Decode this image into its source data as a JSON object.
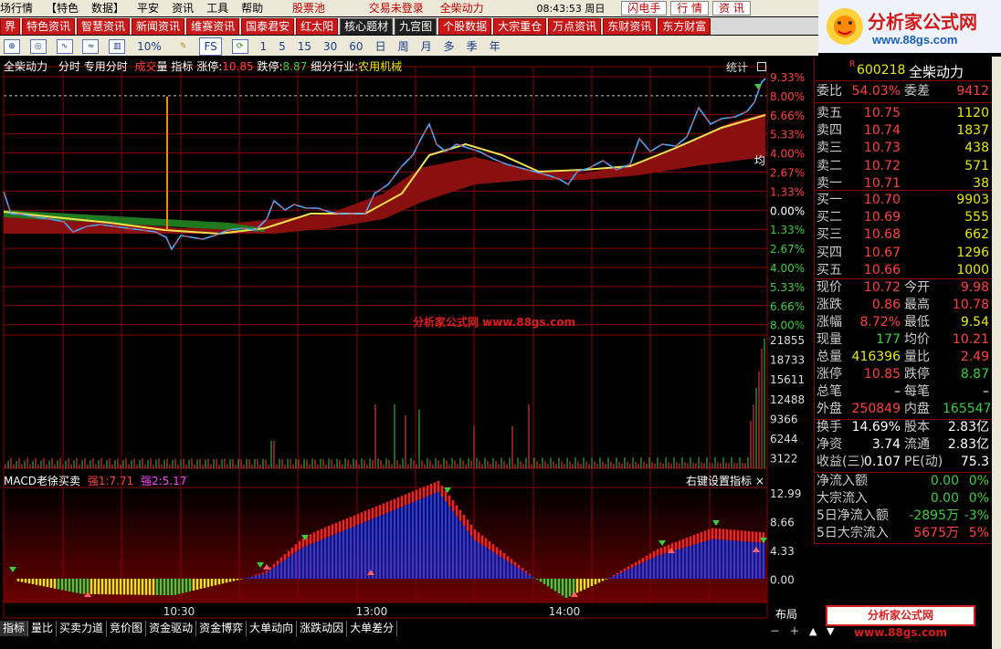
{
  "menubar": {
    "left": [
      "场行情",
      "【特色",
      "数据】",
      "平安",
      "资讯",
      "工具",
      "帮助"
    ],
    "pool": "股票池",
    "trade_status": "交易未登录",
    "stock": "全柴动力",
    "time": "08:43:53 周日",
    "buttons": [
      "闪电手",
      "行 情",
      "资 讯"
    ]
  },
  "logo": {
    "name": "分析家公式网",
    "url": "www.88gs.com"
  },
  "tabs": [
    {
      "label": "界",
      "dark": false
    },
    {
      "label": "特色资讯",
      "dark": false
    },
    {
      "label": "智慧资讯",
      "dark": false
    },
    {
      "label": "新闻资讯",
      "dark": false
    },
    {
      "label": "维赛资讯",
      "dark": false
    },
    {
      "label": "国泰君安",
      "dark": false
    },
    {
      "label": "红太阳",
      "dark": false
    },
    {
      "label": "核心题材",
      "dark": true
    },
    {
      "label": "九宫图",
      "dark": true
    },
    {
      "label": "个股数据",
      "dark": false
    },
    {
      "label": "大宗重仓",
      "dark": false
    },
    {
      "label": "万点资讯",
      "dark": false
    },
    {
      "label": "东财资讯",
      "dark": false
    },
    {
      "label": "东方财富",
      "dark": false
    }
  ],
  "toolbar": {
    "percent": "10%",
    "fs": "FS",
    "periods": [
      "1",
      "5",
      "15",
      "30",
      "60",
      "日",
      "周",
      "月",
      "多",
      "季",
      "年"
    ]
  },
  "info": {
    "name": "全柴动力",
    "mode1": "分时",
    "mode2": "专用分时",
    "vol_a": "成交",
    "vol_b": "量",
    "indicator": "指标",
    "limit_up_label": "涨停:",
    "limit_up": "10.85",
    "limit_down_label": "跌停:",
    "limit_down": "8.87",
    "industry_label": "细分行业:",
    "industry": "农用机械",
    "stat": "统计",
    "mark": "均"
  },
  "watermark": "分析家公式网 www.88gs.com",
  "macd": {
    "title": "MACD老徐买卖",
    "s1_label": "强1:",
    "s1": "7.71",
    "s2_label": "强2:",
    "s2": "5.17",
    "settings": "右键设置指标 ×"
  },
  "price_axis": [
    "9.33%",
    "8.00%",
    "6.66%",
    "5.33%",
    "4.00%",
    "2.67%",
    "1.33%",
    "0.00%",
    "1.33%",
    "2.67%",
    "4.00%",
    "5.33%",
    "6.66%",
    "8.00%"
  ],
  "volume_axis": [
    "21855",
    "18733",
    "15611",
    "12488",
    "9366",
    "6244",
    "3122"
  ],
  "macd_axis": [
    "12.99",
    "8.66",
    "4.33",
    "0.00"
  ],
  "time_axis": [
    "10:30",
    "13:00",
    "14:00"
  ],
  "quote": {
    "code_prefix": "R",
    "code": "600218",
    "name": "全柴动力",
    "wei_bi_label": "委比",
    "wei_bi": "54.03%",
    "wei_cha_label": "委差",
    "wei_cha": "9412",
    "asks": [
      {
        "label": "卖五",
        "price": "10.75",
        "vol": "1120"
      },
      {
        "label": "卖四",
        "price": "10.74",
        "vol": "1837"
      },
      {
        "label": "卖三",
        "price": "10.73",
        "vol": "438"
      },
      {
        "label": "卖二",
        "price": "10.72",
        "vol": "571"
      },
      {
        "label": "卖一",
        "price": "10.71",
        "vol": "38"
      }
    ],
    "bids": [
      {
        "label": "买一",
        "price": "10.70",
        "vol": "9903"
      },
      {
        "label": "买二",
        "price": "10.69",
        "vol": "555"
      },
      {
        "label": "买三",
        "price": "10.68",
        "vol": "662"
      },
      {
        "label": "买四",
        "price": "10.67",
        "vol": "1296"
      },
      {
        "label": "买五",
        "price": "10.66",
        "vol": "1000"
      }
    ],
    "stats": [
      {
        "k1": "现价",
        "v1": "10.72",
        "c1": "red",
        "k2": "今开",
        "v2": "9.98",
        "c2": "red"
      },
      {
        "k1": "涨跌",
        "v1": "0.86",
        "c1": "red",
        "k2": "最高",
        "v2": "10.78",
        "c2": "red"
      },
      {
        "k1": "涨幅",
        "v1": "8.72%",
        "c1": "red",
        "k2": "最低",
        "v2": "9.54",
        "c2": "yel"
      },
      {
        "k1": "现量",
        "v1": "177",
        "c1": "grn",
        "k2": "均价",
        "v2": "10.21",
        "c2": "red"
      },
      {
        "k1": "总量",
        "v1": "416396",
        "c1": "yel",
        "k2": "量比",
        "v2": "2.49",
        "c2": "red"
      },
      {
        "k1": "涨停",
        "v1": "10.85",
        "c1": "red",
        "k2": "跌停",
        "v2": "8.87",
        "c2": "grn"
      },
      {
        "k1": "总笔",
        "v1": "–",
        "c1": "wht",
        "k2": "每笔",
        "v2": "–",
        "c2": "wht"
      },
      {
        "k1": "外盘",
        "v1": "250849",
        "c1": "red",
        "k2": "内盘",
        "v2": "165547",
        "c2": "grn"
      }
    ],
    "stats2": [
      {
        "k1": "换手",
        "v1": "14.69%",
        "c1": "wht",
        "k2": "股本",
        "v2": "2.83亿",
        "c2": "wht"
      },
      {
        "k1": "净资",
        "v1": "3.74",
        "c1": "wht",
        "k2": "流通",
        "v2": "2.83亿",
        "c2": "wht"
      },
      {
        "k1": "收益(三)",
        "v1": "0.107",
        "c1": "wht",
        "k2": "PE(动)",
        "v2": "75.3",
        "c2": "wht"
      }
    ],
    "flows": [
      {
        "k": "净流入额",
        "v1": "0.00",
        "v2": "0%",
        "c": "grn"
      },
      {
        "k": "大宗流入",
        "v1": "0.00",
        "v2": "0%",
        "c": "grn"
      },
      {
        "k": "5日净流入额",
        "v1": "-2895万",
        "v2": "-3%",
        "c": "grn"
      },
      {
        "k": "5日大宗流入",
        "v1": "5675万",
        "v2": "5%",
        "c": "red"
      }
    ]
  },
  "layout_btn": "布局",
  "ad": "分析家公式网 www.88gs.com",
  "bottom_tabs": [
    "指标",
    "量比",
    "买卖力道",
    "竞价图",
    "资金驱动",
    "资金博弈",
    "大单动向",
    "涨跌动因",
    "大单差分"
  ],
  "colors": {
    "up": "#ff4040",
    "down": "#3ccd3c",
    "grid": "#8a0000",
    "yellow": "#e8e800",
    "blue": "#1e3cff",
    "orange": "#ff8a00"
  }
}
